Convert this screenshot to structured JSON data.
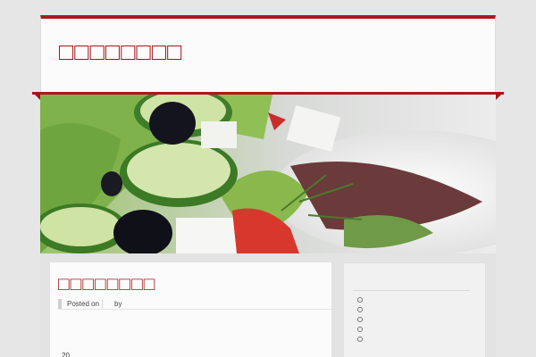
{
  "site": {
    "title": "□□□□□□□□",
    "accent_color": "#b0171b"
  },
  "hero": {
    "image_subject": "salad-photo"
  },
  "article": {
    "title": "□□□□□□□□",
    "meta_posted": "Posted on",
    "meta_by": "by",
    "body_first": "20"
  },
  "sidebar": {
    "widget_items": [
      "",
      "",
      "",
      "",
      ""
    ]
  }
}
